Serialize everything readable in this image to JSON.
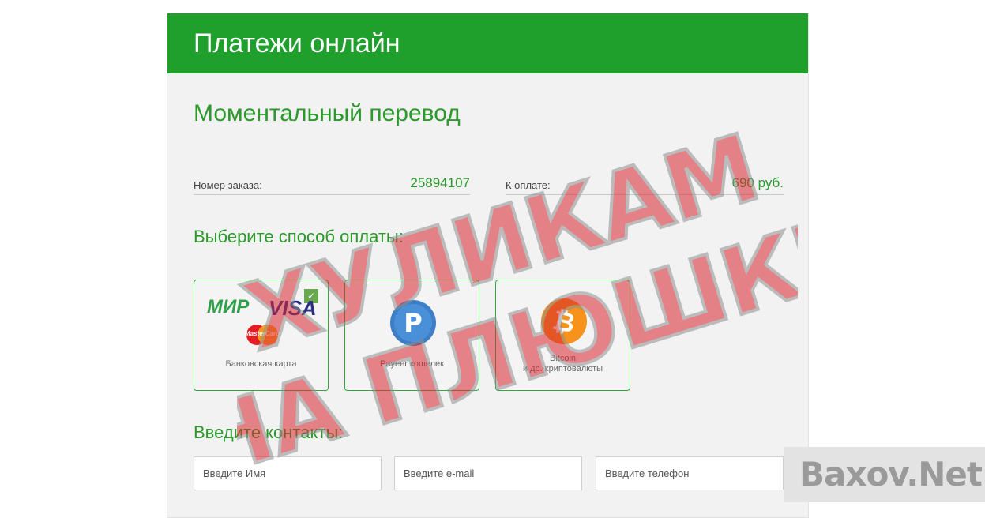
{
  "header": {
    "title": "Платежи онлайн"
  },
  "main": {
    "title": "Моментальный перевод",
    "order": {
      "label": "Номер заказа:",
      "value": "25894107"
    },
    "amount": {
      "label": "К оплате:",
      "value": "690 руб."
    },
    "payment_title": "Выберите способ оплаты:",
    "methods": [
      {
        "label": "Банковская карта",
        "icons": [
          "mir-logo",
          "visa-logo",
          "mastercard-logo"
        ],
        "selected": true
      },
      {
        "label": "Payeer кошелек",
        "icons": [
          "payeer-logo"
        ],
        "selected": false
      },
      {
        "label_line1": "Bitcoin",
        "label_line2": "и др. криптовалюты",
        "icons": [
          "bitcoin-logo"
        ],
        "selected": false
      }
    ],
    "contacts_title": "Введите контакты:",
    "inputs": {
      "name_placeholder": "Введите Имя",
      "email_placeholder": "Введите e-mail",
      "phone_placeholder": "Введите телефон"
    }
  },
  "logos": {
    "mir": "МИР",
    "visa": "VISA",
    "mastercard": "MasterCard"
  },
  "stamp": {
    "line1": "ХУЛИКАМ",
    "line2": "НА ПЛЮШКИ"
  },
  "watermark": {
    "text": "Baxov.Net"
  },
  "colors": {
    "brand_green": "#1fa02c",
    "text_green": "#2a9a2a",
    "stamp_red": "#d8262f",
    "bitcoin_orange": "#f7931a",
    "payeer_blue": "#3d7ec7"
  }
}
